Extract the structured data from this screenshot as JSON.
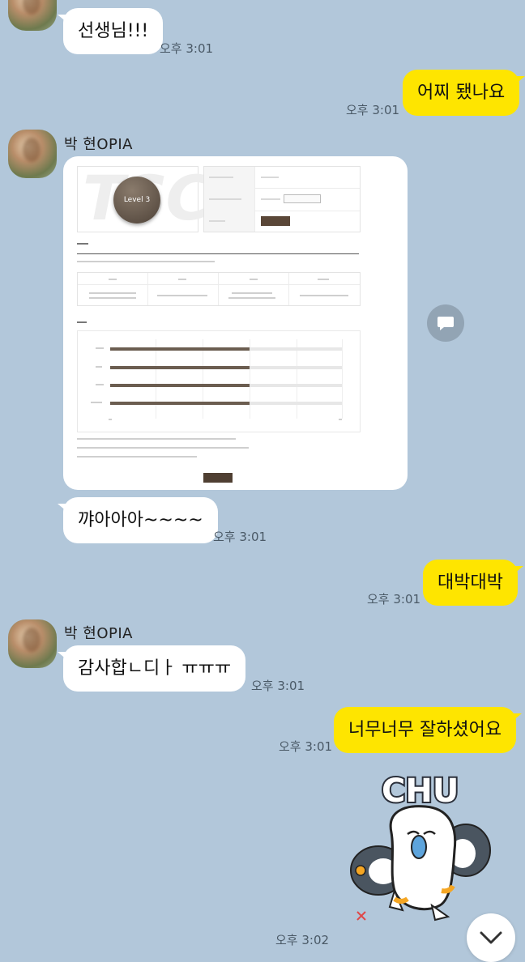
{
  "messages": {
    "m1": {
      "text": "선생님!!!",
      "time": "오후 3:01"
    },
    "m2": {
      "text": "어찌 됐나요",
      "time": "오후 3:01"
    },
    "sender1": "박   현OPIA",
    "image_msg": {
      "level_badge": "Level 3",
      "logo_text": "TSC"
    },
    "m4": {
      "text": "꺄아아아~~~~",
      "time": "오후 3:01"
    },
    "m5": {
      "text": "대박대박",
      "time": "오후 3:01"
    },
    "sender2": "박   현OPIA",
    "m6": {
      "text": "감사합ㄴ디ㅏ ㅠㅠㅠ",
      "time": "오후 3:01"
    },
    "m7": {
      "text": "너무너무 잘하셨어요",
      "time": "오후 3:01"
    },
    "sticker": {
      "text": "CHU",
      "time": "오후 3:02"
    }
  },
  "colors": {
    "background": "#b2c7da",
    "incoming_bubble": "#ffffff",
    "outgoing_bubble": "#fee500"
  },
  "icons": {
    "share": "share-icon",
    "scroll_down": "chevron-down-icon"
  }
}
